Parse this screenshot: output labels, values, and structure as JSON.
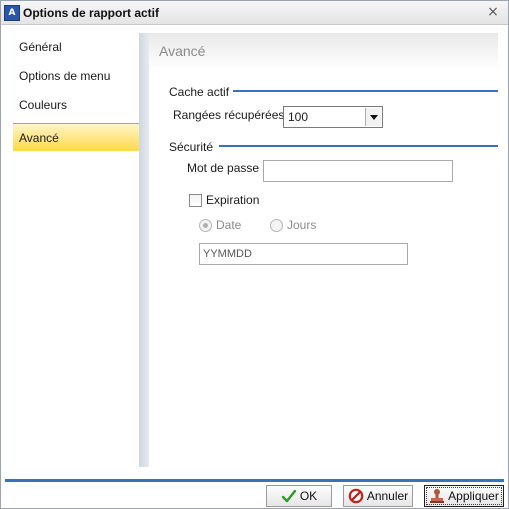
{
  "window": {
    "title": "Options de rapport actif",
    "icon": "report-app-icon",
    "close_glyph": "×"
  },
  "sidebar": {
    "items": [
      {
        "label": "Général"
      },
      {
        "label": "Options de menu"
      },
      {
        "label": "Couleurs"
      },
      {
        "label": "Avancé",
        "active": true
      }
    ]
  },
  "content": {
    "title": "Avancé",
    "cache": {
      "section_label": "Cache actif",
      "rows_label": "Rangées récupérées",
      "rows_value": "100"
    },
    "security": {
      "section_label": "Sécurité",
      "password_label": "Mot de passe",
      "password_value": "",
      "expiration_label": "Expiration",
      "expiration_checked": false,
      "radio_date_label": "Date",
      "radio_days_label": "Jours",
      "date_format_value": "YYMMDD"
    }
  },
  "footer": {
    "ok_label": "OK",
    "cancel_label": "Annuler",
    "apply_label": "Appliquer"
  },
  "colors": {
    "accent": "#3b6fc2",
    "active_nav": "#ffd84a"
  }
}
